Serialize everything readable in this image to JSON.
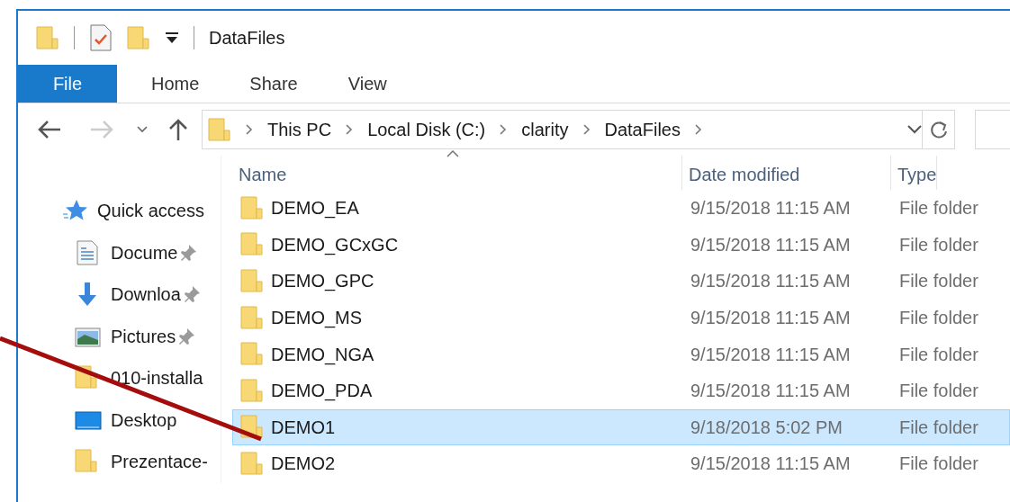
{
  "title_bar": {
    "title": "DataFiles"
  },
  "ribbon_tabs": [
    {
      "label": "File",
      "selected": true
    },
    {
      "label": "Home",
      "selected": false
    },
    {
      "label": "Share",
      "selected": false
    },
    {
      "label": "View",
      "selected": false
    }
  ],
  "address_bar": {
    "breadcrumbs": [
      "This PC",
      "Local Disk (C:)",
      "clarity",
      "DataFiles"
    ]
  },
  "navigation_pane": [
    {
      "label": "Quick access",
      "kind": "quick-access",
      "pinned": false
    },
    {
      "label": "Docume",
      "kind": "documents",
      "pinned": true
    },
    {
      "label": "Downloa",
      "kind": "downloads",
      "pinned": true
    },
    {
      "label": "Pictures",
      "kind": "pictures",
      "pinned": true
    },
    {
      "label": "010-installa",
      "kind": "folder",
      "pinned": false
    },
    {
      "label": "Desktop",
      "kind": "desktop",
      "pinned": false
    },
    {
      "label": "Prezentace-",
      "kind": "folder",
      "pinned": false
    }
  ],
  "file_list": {
    "columns": [
      {
        "label": "Name",
        "sorted": true
      },
      {
        "label": "Date modified",
        "sorted": false
      },
      {
        "label": "Type",
        "sorted": false
      }
    ],
    "rows": [
      {
        "name": "DEMO_EA",
        "date_modified": "9/15/2018 11:15 AM",
        "type": "File folder",
        "selected": false
      },
      {
        "name": "DEMO_GCxGC",
        "date_modified": "9/15/2018 11:15 AM",
        "type": "File folder",
        "selected": false
      },
      {
        "name": "DEMO_GPC",
        "date_modified": "9/15/2018 11:15 AM",
        "type": "File folder",
        "selected": false
      },
      {
        "name": "DEMO_MS",
        "date_modified": "9/15/2018 11:15 AM",
        "type": "File folder",
        "selected": false
      },
      {
        "name": "DEMO_NGA",
        "date_modified": "9/15/2018 11:15 AM",
        "type": "File folder",
        "selected": false
      },
      {
        "name": "DEMO_PDA",
        "date_modified": "9/15/2018 11:15 AM",
        "type": "File folder",
        "selected": false
      },
      {
        "name": "DEMO1",
        "date_modified": "9/18/2018 5:02 PM",
        "type": "File folder",
        "selected": true
      },
      {
        "name": "DEMO2",
        "date_modified": "9/15/2018 11:15 AM",
        "type": "File folder",
        "selected": false
      }
    ]
  }
}
